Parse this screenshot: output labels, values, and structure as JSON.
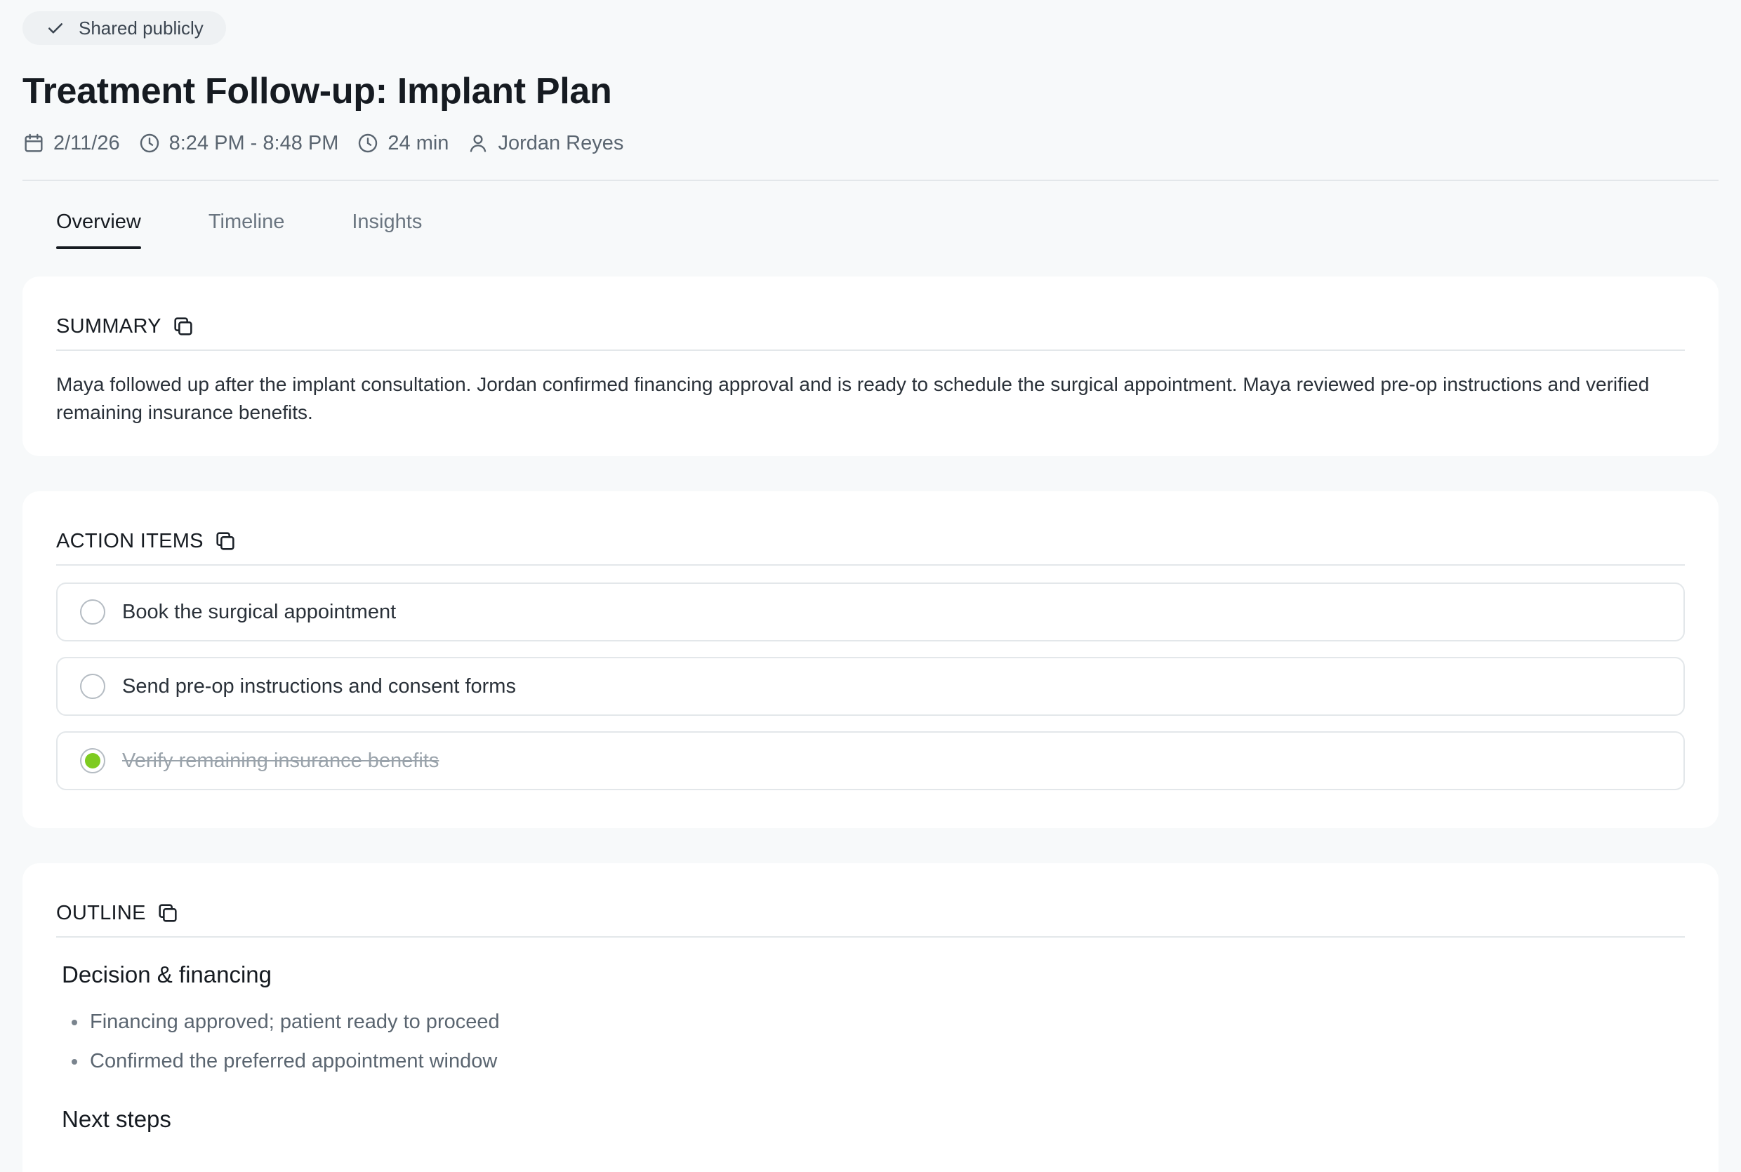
{
  "badge": {
    "label": "Shared publicly",
    "icon": "check-icon"
  },
  "meeting": {
    "title": "Treatment Follow-up: Implant Plan",
    "date": "2/11/26",
    "time_range": "8:24 PM - 8:48 PM",
    "duration": "24 min",
    "participant": "Jordan Reyes"
  },
  "tabs": [
    {
      "label": "Overview",
      "active": true
    },
    {
      "label": "Timeline",
      "active": false
    },
    {
      "label": "Insights",
      "active": false
    }
  ],
  "summary": {
    "heading": "SUMMARY",
    "text": "Maya followed up after the implant consultation. Jordan confirmed financing approval and is ready to schedule the surgical appointment. Maya reviewed pre-op instructions and verified remaining insurance benefits."
  },
  "action_items": {
    "heading": "ACTION ITEMS",
    "items": [
      {
        "label": "Book the surgical appointment",
        "done": false
      },
      {
        "label": "Send pre-op instructions and consent forms",
        "done": false
      },
      {
        "label": "Verify remaining insurance benefits",
        "done": true
      }
    ]
  },
  "outline": {
    "heading": "OUTLINE",
    "sections": [
      {
        "title": "Decision & financing",
        "bullets": [
          "Financing approved; patient ready to proceed",
          "Confirmed the preferred appointment window"
        ]
      },
      {
        "title": "Next steps",
        "bullets": []
      }
    ]
  },
  "colors": {
    "done_dot": "#7ecb20",
    "background": "#f7f9fa",
    "card": "#ffffff"
  }
}
